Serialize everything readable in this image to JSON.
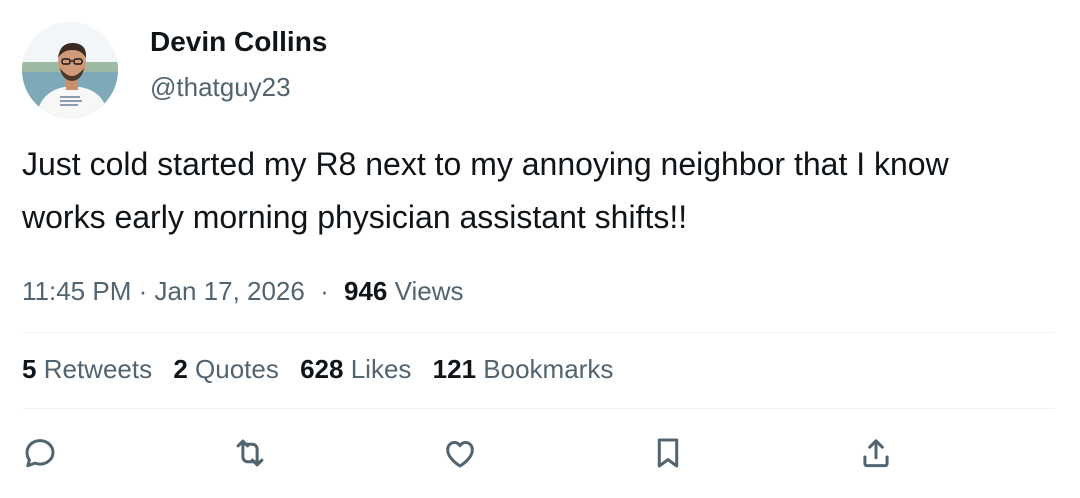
{
  "user": {
    "display_name": "Devin Collins",
    "handle": "@thatguy23"
  },
  "tweet": {
    "line1": "Just cold started my R8 next to my annoying neighbor that I know",
    "line2": "works early morning physician assistant shifts!!"
  },
  "meta": {
    "time": "11:45 PM",
    "separator": "·",
    "date": "Jan 17, 2026",
    "views_count": "946",
    "views_label": "Views"
  },
  "stats": {
    "retweets_count": "5",
    "retweets_label": "Retweets",
    "quotes_count": "2",
    "quotes_label": "Quotes",
    "likes_count": "628",
    "likes_label": "Likes",
    "bookmarks_count": "121",
    "bookmarks_label": "Bookmarks"
  },
  "actions": [
    {
      "icon": "reply-icon"
    },
    {
      "icon": "retweet-icon"
    },
    {
      "icon": "like-icon"
    },
    {
      "icon": "bookmark-icon"
    },
    {
      "icon": "share-icon"
    }
  ],
  "colors": {
    "text_primary": "#0f1419",
    "text_secondary": "#536471",
    "divider": "#eff3f4"
  }
}
